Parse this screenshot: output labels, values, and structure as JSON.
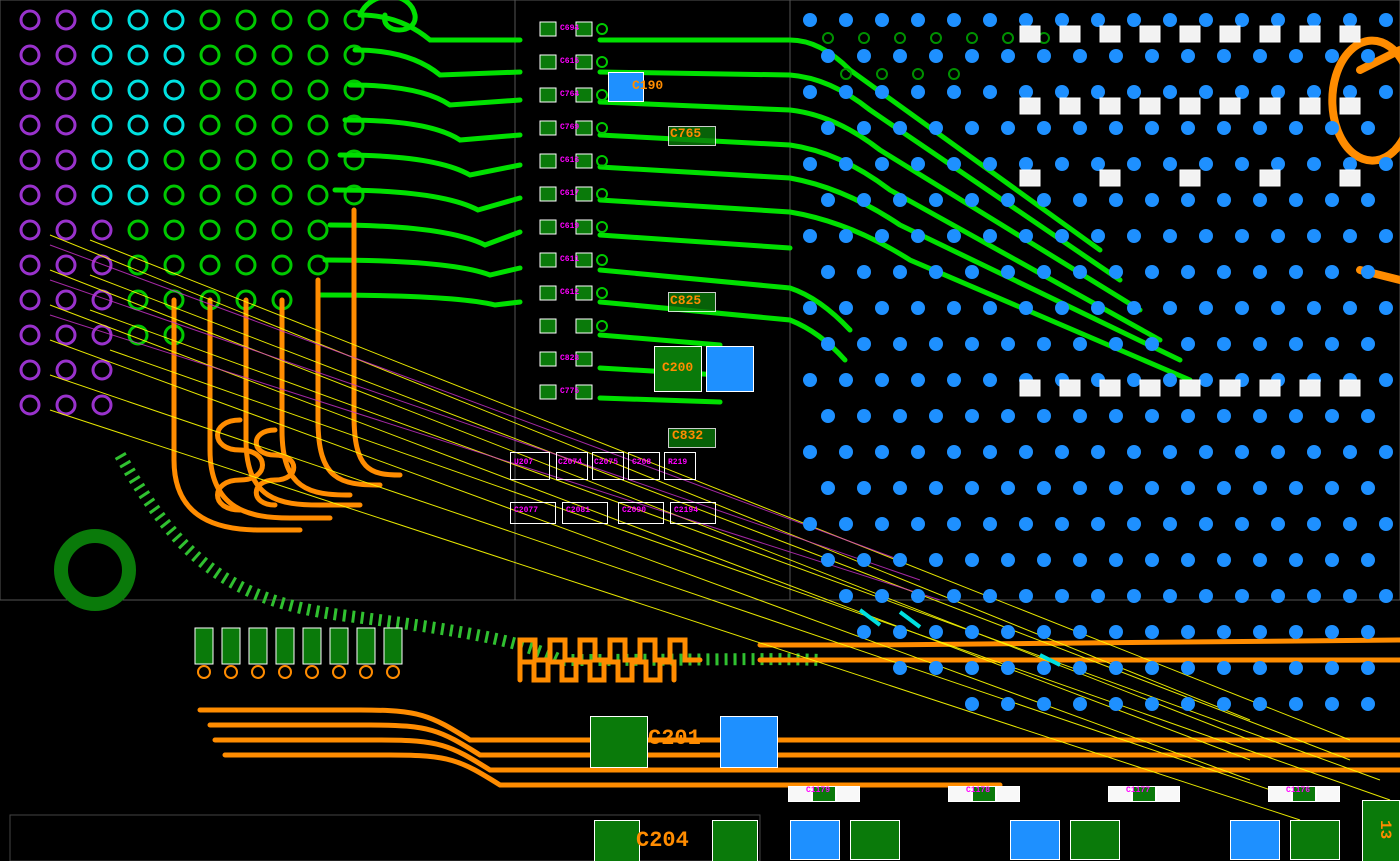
{
  "refs": {
    "c190": "C190",
    "c765": "C765",
    "c825": "C825",
    "c200": "C200",
    "c832": "C832",
    "c201": "C201",
    "c204": "C204",
    "c1179": "C1179",
    "c1178": "C1178",
    "c1177": "C1177",
    "c1176": "C1176",
    "c694": "C694",
    "c615": "C615",
    "c764": "C764",
    "c769": "C769",
    "c616": "C616",
    "c617": "C617",
    "c619": "C619",
    "c611": "C611",
    "c612": "C612",
    "c828": "C828",
    "c775": "C775",
    "u207": "U207",
    "c2074": "C2074",
    "c2075": "C2075",
    "c208": "C208",
    "c2077": "C2077",
    "c2081": "C2081",
    "c2090": "C2090",
    "c2194": "C2194",
    "r219": "R219",
    "r2133": "13"
  },
  "colors": {
    "bg": "#000000",
    "trace_green": "#00ff00",
    "trace_orange": "#ff8c00",
    "trace_cyan": "#00ffff",
    "via_violet": "#9932cc",
    "via_blue": "#1e90ff",
    "via_green": "#0a7a0a",
    "ratsnest": "#ffff00",
    "outline": "#ffffff",
    "text_orange": "#ff8c00",
    "text_magenta": "#ff00ff",
    "pad_white": "#f8f8f8"
  },
  "layers": {
    "top_copper": "green",
    "inner_copper": "orange",
    "silkscreen": "cyan",
    "vias": [
      "violet",
      "blue",
      "green"
    ],
    "unrouted_nets": "yellow"
  }
}
